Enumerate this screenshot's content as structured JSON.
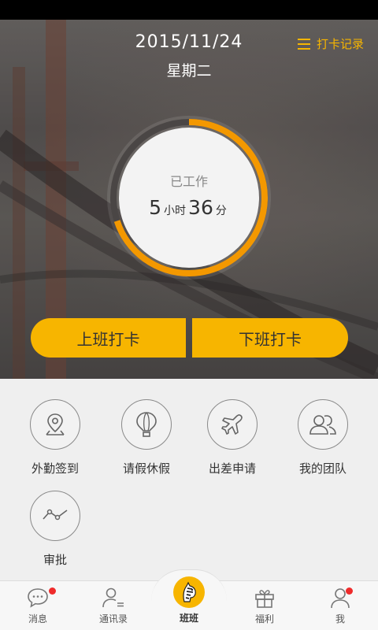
{
  "header": {
    "date": "2015/11/24",
    "weekday": "星期二",
    "record_link": "打卡记录",
    "record_icon": "menu-lines-icon",
    "accent_color": "#f7b500"
  },
  "worked": {
    "label": "已工作",
    "hours": "5",
    "hours_unit": "小时",
    "minutes": "36",
    "minutes_unit": "分",
    "progress": 0.7
  },
  "buttons": {
    "clock_in": "上班打卡",
    "clock_out": "下班打卡"
  },
  "features": [
    {
      "label": "外勤签到",
      "icon": "location-pin-icon"
    },
    {
      "label": "请假休假",
      "icon": "hot-air-balloon-icon"
    },
    {
      "label": "出差申请",
      "icon": "airplane-icon"
    },
    {
      "label": "我的团队",
      "icon": "team-icon"
    },
    {
      "label": "审批",
      "icon": "trend-line-icon"
    }
  ],
  "tabs": [
    {
      "label": "消息",
      "icon": "chat-bubble-icon",
      "badge": true
    },
    {
      "label": "通讯录",
      "icon": "contacts-icon",
      "badge": false
    },
    {
      "label": "班班",
      "icon": "zebra-avatar-icon",
      "badge": false
    },
    {
      "label": "福利",
      "icon": "gift-icon",
      "badge": false
    },
    {
      "label": "我",
      "icon": "profile-icon",
      "badge": true
    }
  ]
}
